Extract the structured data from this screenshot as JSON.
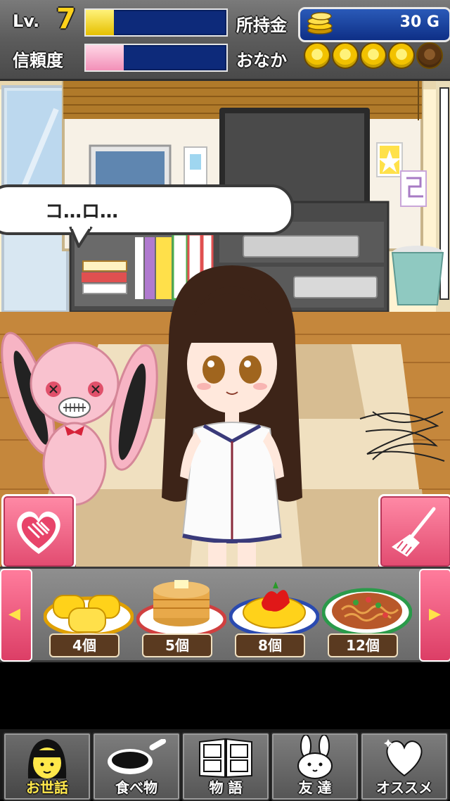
{
  "status": {
    "level_label": "Lv.",
    "level_value": "7",
    "level_progress": 0.2,
    "trust_label": "信頼度",
    "trust_progress": 0.27,
    "money_label": "所持金",
    "money_value": "30 G",
    "hunger_label": "おなか",
    "hunger_full": 4,
    "hunger_total": 5
  },
  "speech": {
    "text": "コ…ロ…"
  },
  "actions": {
    "pet": "pet-button",
    "clean": "clean-button"
  },
  "food": [
    {
      "name": "tamagoyaki",
      "count": "4個"
    },
    {
      "name": "pancakes",
      "count": "5個"
    },
    {
      "name": "omurice",
      "count": "8個"
    },
    {
      "name": "yakisoba",
      "count": "12個"
    }
  ],
  "nav": [
    {
      "label": "お世話",
      "icon": "girl-face-icon",
      "active": true
    },
    {
      "label": "食べ物",
      "icon": "frying-pan-icon"
    },
    {
      "label": "物 語",
      "icon": "book-icon"
    },
    {
      "label": "友 達",
      "icon": "rabbit-icon"
    },
    {
      "label": "オススメ",
      "icon": "heart-icon"
    }
  ],
  "colors": {
    "accent_pink": "#e24b70",
    "gold": "#ffd21a",
    "bar_blue": "#0d2a7a"
  }
}
